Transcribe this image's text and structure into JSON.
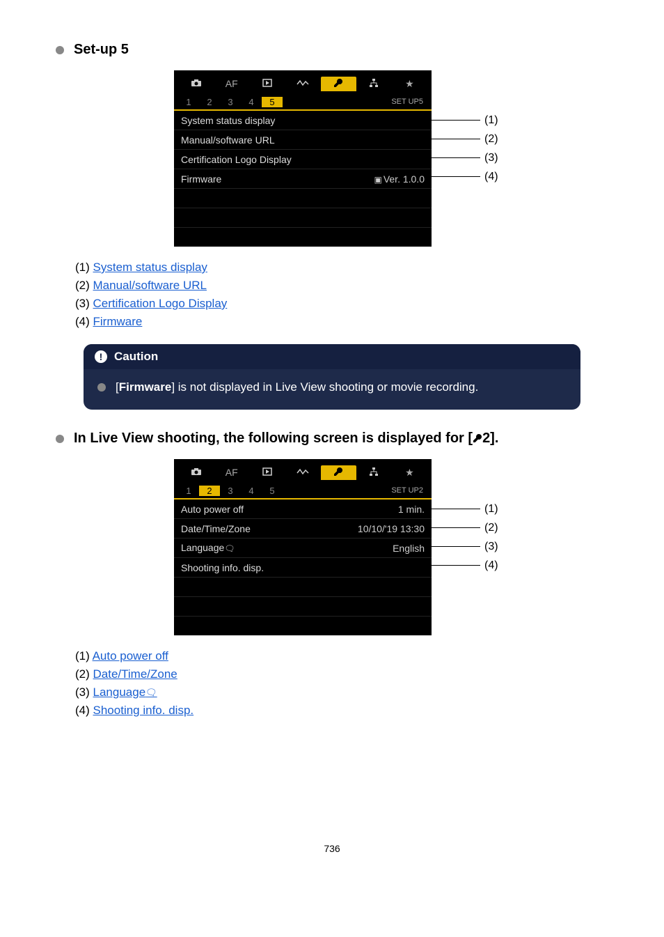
{
  "sections": [
    {
      "title": "Set-up 5",
      "sub_label": "SET UP5",
      "active_page": "5",
      "pages": [
        "1",
        "2",
        "3",
        "4",
        "5"
      ],
      "menu": [
        {
          "label": "System status display",
          "value": ""
        },
        {
          "label": "Manual/software URL",
          "value": ""
        },
        {
          "label": "Certification Logo Display",
          "value": ""
        },
        {
          "label": "Firmware",
          "value": "Ver. 1.0.0",
          "has_cam_icon": true
        }
      ],
      "legend": [
        {
          "num": "(1)",
          "text": "System status display"
        },
        {
          "num": "(2)",
          "text": "Manual/software URL"
        },
        {
          "num": "(3)",
          "text": "Certification Logo Display"
        },
        {
          "num": "(4)",
          "text": "Firmware"
        }
      ]
    },
    {
      "title_prefix": "In Live View shooting, the following screen is displayed for [",
      "title_suffix": "2].",
      "sub_label": "SET UP2",
      "active_page": "2",
      "pages": [
        "1",
        "2",
        "3",
        "4",
        "5"
      ],
      "menu": [
        {
          "label": "Auto power off",
          "value": "1 min."
        },
        {
          "label": "Date/Time/Zone",
          "value": "10/10/'19 13:30"
        },
        {
          "label": "Language",
          "value": "English",
          "has_lang_icon": true
        },
        {
          "label": "Shooting info. disp.",
          "value": ""
        }
      ],
      "legend": [
        {
          "num": "(1)",
          "text": "Auto power off"
        },
        {
          "num": "(2)",
          "text": "Date/Time/Zone"
        },
        {
          "num": "(3)",
          "text": "Language",
          "has_icon": true
        },
        {
          "num": "(4)",
          "text": "Shooting info. disp."
        }
      ]
    }
  ],
  "caution": {
    "title": "Caution",
    "body_prefix": "[",
    "body_bold": "Firmware",
    "body_suffix": "] is not displayed in Live View shooting or movie recording."
  },
  "top_tabs": {
    "labels": [
      "camera",
      "AF",
      "play",
      "wave",
      "wrench",
      "network",
      "star"
    ]
  },
  "page_number": "736"
}
